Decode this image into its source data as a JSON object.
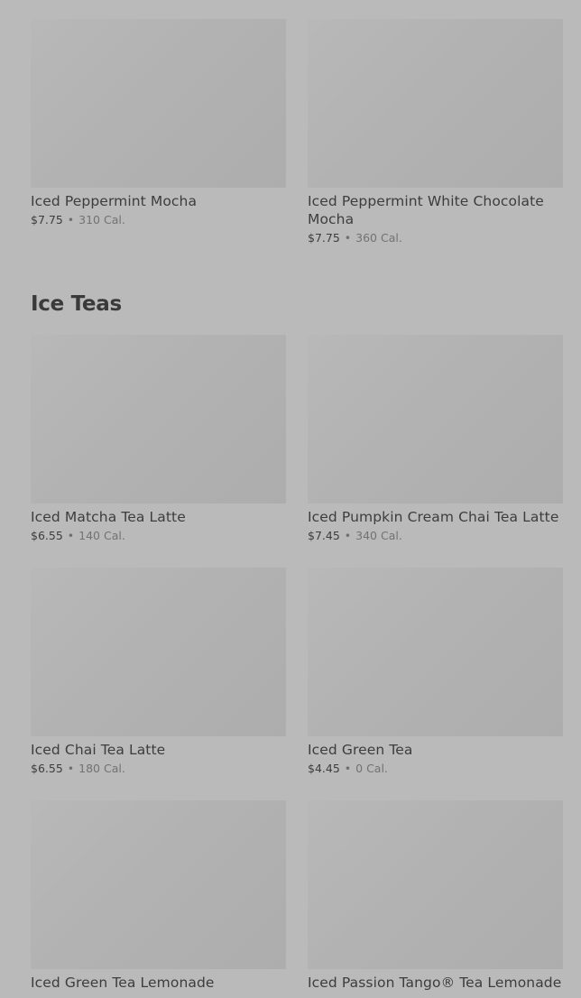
{
  "sections": [
    {
      "title": "",
      "items": [
        {
          "name": "Iced Peppermint Mocha",
          "price": "$7.75",
          "calories": "310 Cal."
        },
        {
          "name": "Iced Peppermint White Chocolate Mocha",
          "price": "$7.75",
          "calories": "360 Cal."
        }
      ]
    },
    {
      "title": "Ice Teas",
      "items": [
        {
          "name": "Iced Matcha Tea Latte",
          "price": "$6.55",
          "calories": "140 Cal."
        },
        {
          "name": "Iced Pumpkin Cream Chai Tea Latte",
          "price": "$7.45",
          "calories": "340 Cal."
        },
        {
          "name": "Iced Chai Tea Latte",
          "price": "$6.55",
          "calories": "180 Cal."
        },
        {
          "name": "Iced Green Tea",
          "price": "$4.45",
          "calories": "0 Cal."
        },
        {
          "name": "Iced Green Tea Lemonade",
          "price": "",
          "calories": ""
        },
        {
          "name": "Iced Passion Tango® Tea Lemonade",
          "price": "",
          "calories": ""
        }
      ]
    }
  ],
  "separator": "•"
}
